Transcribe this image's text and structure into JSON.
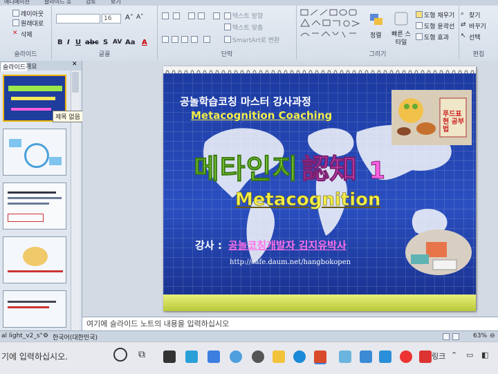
{
  "ribbon": {
    "tabs": [
      "애니메이션",
      "슬라이드 쇼",
      "검토",
      "보기"
    ],
    "slides_group": {
      "label": "슬라이드",
      "layout": "레이아웃",
      "reset": "원래대로",
      "delete": "삭제"
    },
    "font_group": {
      "label": "글꼴",
      "size": "16"
    },
    "paragraph_group": {
      "label": "단락",
      "text_direction": "텍스트 방향",
      "align_text": "텍스트 맞춤",
      "smartart": "SmartArt로 변환"
    },
    "drawing_group": {
      "label": "그리기",
      "arrange": "정렬",
      "quick_styles": "빠른 스타일",
      "fill": "도형 채우기",
      "outline": "도형 윤곽선",
      "effects": "도형 효과"
    },
    "editing_group": {
      "label": "편집",
      "find": "찾기",
      "replace": "바꾸기",
      "select": "선택"
    }
  },
  "left_panel": {
    "tabs": [
      "슬라이드",
      "개요"
    ],
    "tooltip": "제목 없음"
  },
  "slide": {
    "line1": "공놀학습코칭 마스터 강사과정",
    "line2": "Metacognition Coaching",
    "title_ko": "메타인지",
    "title_hanja": "認知",
    "title_num": "1",
    "subtitle": "Metacognition",
    "presenter_prefix": "강사 :",
    "presenter": "공놀코칭개발자 김지유박사",
    "url": "http://cafe.daum.net/hangbokopen",
    "book_label": "푸드표현 공부법"
  },
  "notes": {
    "placeholder": "여기에 슬라이드 노트의 내용을 입력하십시오"
  },
  "status": {
    "file": "al light_v2_s\"",
    "language": "한국어(대한민국)",
    "zoom": "63%"
  },
  "taskbar": {
    "search_placeholder": "기에 입력하십시오.",
    "tray_text": "링크"
  }
}
